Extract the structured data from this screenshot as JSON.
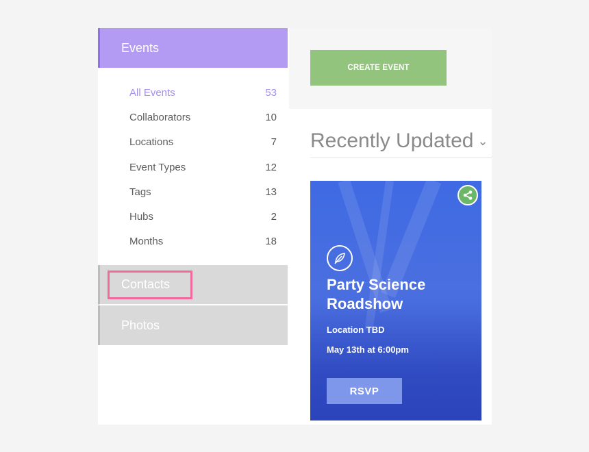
{
  "sidebar": {
    "events_header": "Events",
    "items": [
      {
        "label": "All Events",
        "count": "53",
        "active": true
      },
      {
        "label": "Collaborators",
        "count": "10"
      },
      {
        "label": "Locations",
        "count": "7"
      },
      {
        "label": "Event Types",
        "count": "12"
      },
      {
        "label": "Tags",
        "count": "13"
      },
      {
        "label": "Hubs",
        "count": "2"
      },
      {
        "label": "Months",
        "count": "18"
      }
    ],
    "contacts_header": "Contacts",
    "photos_header": "Photos"
  },
  "main": {
    "create_button": "CREATE EVENT",
    "section_title": "Recently Updated",
    "card": {
      "title": "Party Science Roadshow",
      "location": "Location TBD",
      "date": "May 13th at 6:00pm",
      "rsvp_label": "RSVP"
    }
  },
  "colors": {
    "accent_purple": "#b39bf3",
    "create_green": "#93c47d",
    "card_blue": "#4a6fe0",
    "highlight_pink": "#f06a9b"
  },
  "icons": {
    "share": "share-icon",
    "leaf": "leaf-icon",
    "chevron": "chevron-down-icon"
  }
}
